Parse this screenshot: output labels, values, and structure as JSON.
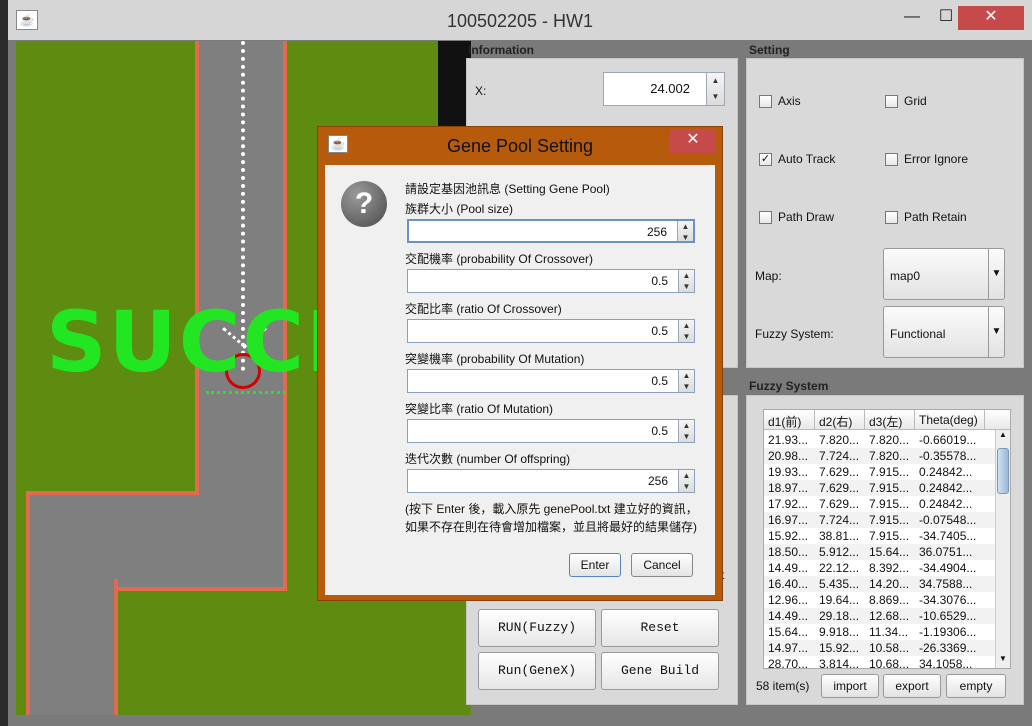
{
  "window": {
    "title": "100502205 - HW1",
    "minimize": "—",
    "maximize": "☐",
    "close": "✕"
  },
  "canvas": {
    "success_text": "SUCCE"
  },
  "information": {
    "label": "Information",
    "x_label": "X:",
    "x_value": "24.002"
  },
  "setting": {
    "label": "Setting",
    "axis": "Axis",
    "grid": "Grid",
    "auto_track": "Auto Track",
    "error_ignore": "Error Ignore",
    "path_draw": "Path Draw",
    "path_retain": "Path Retain",
    "map_label": "Map:",
    "map_value": "map0",
    "fuzzy_label": "Fuzzy System:",
    "fuzzy_value": "Functional"
  },
  "fuzzy_system": {
    "label": "Fuzzy System",
    "columns": [
      "d1(前)",
      "d2(右)",
      "d3(左)",
      "Theta(deg)"
    ],
    "rows": [
      [
        "21.93...",
        "7.820...",
        "7.820...",
        "-0.66019..."
      ],
      [
        "20.98...",
        "7.724...",
        "7.820...",
        "-0.35578..."
      ],
      [
        "19.93...",
        "7.629...",
        "7.915...",
        "0.24842..."
      ],
      [
        "18.97...",
        "7.629...",
        "7.915...",
        "0.24842..."
      ],
      [
        "17.92...",
        "7.629...",
        "7.915...",
        "0.24842..."
      ],
      [
        "16.97...",
        "7.724...",
        "7.915...",
        "-0.07548..."
      ],
      [
        "15.92...",
        "38.81...",
        "7.915...",
        "-34.7405..."
      ],
      [
        "18.50...",
        "5.912...",
        "15.64...",
        "36.0751..."
      ],
      [
        "14.49...",
        "22.12...",
        "8.392...",
        "-34.4904..."
      ],
      [
        "16.40...",
        "5.435...",
        "14.20...",
        "34.7588..."
      ],
      [
        "12.96...",
        "19.64...",
        "8.869...",
        "-34.3076..."
      ],
      [
        "14.49...",
        "29.18...",
        "12.68...",
        "-10.6529..."
      ],
      [
        "15.64...",
        "9.918...",
        "11.34...",
        "-1.19306..."
      ],
      [
        "14.97...",
        "15.92...",
        "10.58...",
        "-26.3369..."
      ],
      [
        "28.70...",
        "3.814...",
        "10.68...",
        "34.1058..."
      ]
    ],
    "count": "58 item(s)",
    "import": "import",
    "export": "export",
    "empty": "empty"
  },
  "controls": {
    "run_fuzzy": "RUN(Fuzzy)",
    "reset": "Reset",
    "run_genex": "Run(GeneX)",
    "gene_build": "Gene Build",
    "partial_label": "st"
  },
  "dialog": {
    "title": "Gene Pool Setting",
    "heading": "請設定基因池訊息 (Setting Gene Pool)",
    "pool_size_label": "族群大小 (Pool size)",
    "pool_size": "256",
    "crossover_prob_label": "交配機率 (probability Of Crossover)",
    "crossover_prob": "0.5",
    "crossover_ratio_label": "交配比率 (ratio Of Crossover)",
    "crossover_ratio": "0.5",
    "mutation_prob_label": "突變機率 (probability Of Mutation)",
    "mutation_prob": "0.5",
    "mutation_ratio_label": "突變比率 (ratio Of Mutation)",
    "mutation_ratio": "0.5",
    "offspring_label": "迭代次數 (number Of offspring)",
    "offspring": "256",
    "note_line1": "(按下 Enter 後，載入原先 genePool.txt 建立好的資訊，",
    "note_line2": "如果不存在則在待會增加檔案，並且將最好的結果儲存)",
    "enter": "Enter",
    "cancel": "Cancel",
    "close": "✕"
  },
  "colors": {
    "field": "#5e8c10",
    "track": "#7f7f7f",
    "track_border": "#e06b4e",
    "success": "#22e622",
    "dialog_frame": "#b65a0c"
  }
}
